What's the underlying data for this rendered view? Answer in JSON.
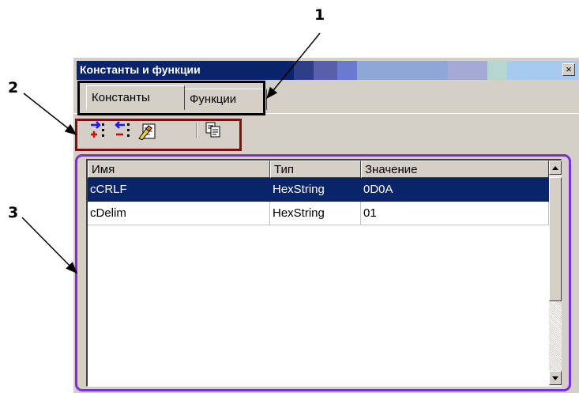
{
  "callouts": {
    "n1": "1",
    "n2": "2",
    "n3": "3"
  },
  "window": {
    "title": "Константы и функции",
    "close_label": "×"
  },
  "tabs": [
    {
      "label": "Константы",
      "active": true
    },
    {
      "label": "Функции",
      "active": false
    }
  ],
  "toolbar": {
    "buttons": [
      {
        "icon": "add-constant-icon"
      },
      {
        "icon": "remove-constant-icon"
      },
      {
        "icon": "edit-constant-icon"
      },
      {
        "icon": "copy-icon"
      }
    ]
  },
  "table": {
    "columns": [
      "Имя",
      "Тип",
      "Значение"
    ],
    "rows": [
      {
        "name": "cCRLF",
        "type": "HexString",
        "value": "0D0A",
        "selected": true
      },
      {
        "name": "cDelim",
        "type": "HexString",
        "value": "01",
        "selected": false
      }
    ]
  },
  "colors": {
    "title_bar": "#0a246a",
    "selection": "#0a246a",
    "callout_box_1": "#000000",
    "callout_box_2": "#7a1010",
    "callout_box_3": "#7a2fd8"
  }
}
